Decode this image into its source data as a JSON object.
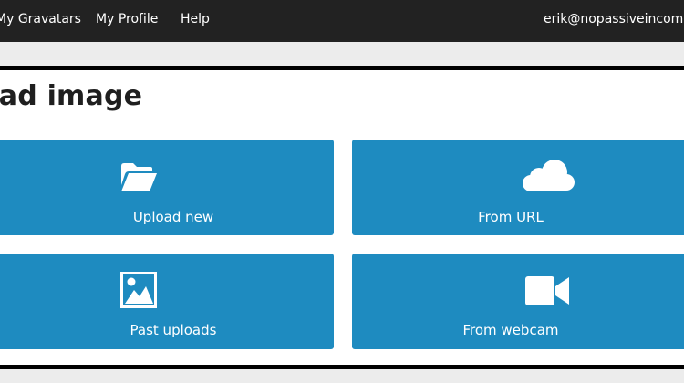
{
  "topbar": {
    "nav": {
      "my_gravatars": "My Gravatars",
      "my_profile": "My Profile",
      "help": "Help"
    },
    "account_email": "erik@nopassiveincome.c"
  },
  "page": {
    "title": "oad image"
  },
  "tiles": {
    "upload_new": {
      "label": "Upload new",
      "icon": "folder-open-icon"
    },
    "from_url": {
      "label": "From URL",
      "icon": "cloud-icon"
    },
    "past_uploads": {
      "label": "Past uploads",
      "icon": "image-icon"
    },
    "from_webcam": {
      "label": "From webcam",
      "icon": "video-camera-icon"
    }
  },
  "colors": {
    "topbar_bg": "#222222",
    "tile_bg": "#1e8bc0",
    "page_bg": "#ececec"
  }
}
